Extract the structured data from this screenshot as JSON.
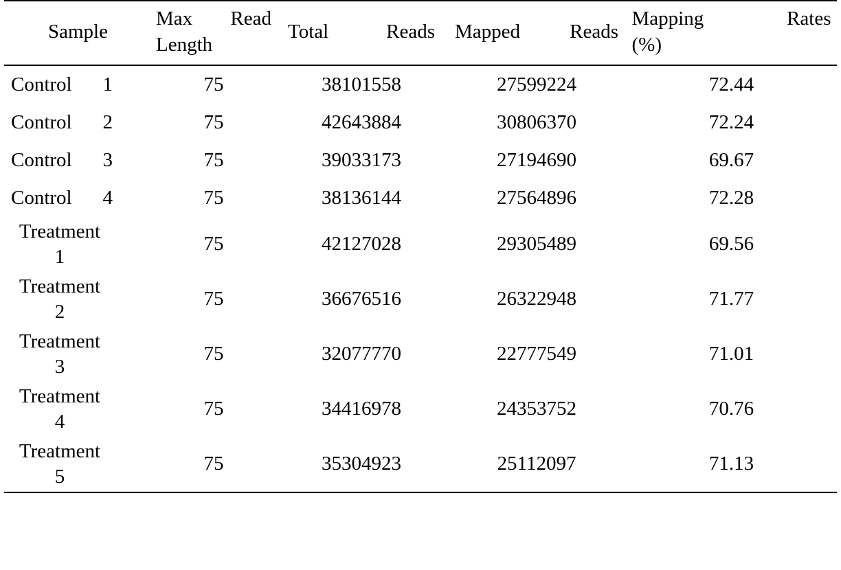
{
  "table": {
    "columns": [
      {
        "key": "sample",
        "label": "Sample"
      },
      {
        "key": "max_read_length",
        "label": "Max Read Length"
      },
      {
        "key": "total_reads",
        "label": "Total Reads"
      },
      {
        "key": "mapped_reads",
        "label": "Mapped Reads"
      },
      {
        "key": "mapping_rates",
        "label": "Mapping Rates (%)"
      }
    ],
    "header_lines": {
      "sample": {
        "line1": "Sample",
        "line2": ""
      },
      "max_read_length": {
        "line1": "Max Read",
        "line2": "Length"
      },
      "total_reads": {
        "line1": "Total Reads",
        "line2": ""
      },
      "mapped_reads": {
        "line1": "Mapped Reads",
        "line2": ""
      },
      "mapping_rates": {
        "line1": "Mapping Rates",
        "line2": "(%)"
      }
    },
    "rows": [
      {
        "sample": "Control 1",
        "sample_line1": "Control 1",
        "sample_line2": "",
        "max_read_length": "75",
        "total_reads": "38101558",
        "mapped_reads": "27599224",
        "mapping_rates": "72.44"
      },
      {
        "sample": "Control 2",
        "sample_line1": "Control 2",
        "sample_line2": "",
        "max_read_length": "75",
        "total_reads": "42643884",
        "mapped_reads": "30806370",
        "mapping_rates": "72.24"
      },
      {
        "sample": "Control 3",
        "sample_line1": "Control 3",
        "sample_line2": "",
        "max_read_length": "75",
        "total_reads": "39033173",
        "mapped_reads": "27194690",
        "mapping_rates": "69.67"
      },
      {
        "sample": "Control 4",
        "sample_line1": "Control 4",
        "sample_line2": "",
        "max_read_length": "75",
        "total_reads": "38136144",
        "mapped_reads": "27564896",
        "mapping_rates": "72.28"
      },
      {
        "sample": "Treatment 1",
        "sample_line1": "Treatment",
        "sample_line2": "1",
        "max_read_length": "75",
        "total_reads": "42127028",
        "mapped_reads": "29305489",
        "mapping_rates": "69.56"
      },
      {
        "sample": "Treatment 2",
        "sample_line1": "Treatment",
        "sample_line2": "2",
        "max_read_length": "75",
        "total_reads": "36676516",
        "mapped_reads": "26322948",
        "mapping_rates": "71.77"
      },
      {
        "sample": "Treatment 3",
        "sample_line1": "Treatment",
        "sample_line2": "3",
        "max_read_length": "75",
        "total_reads": "32077770",
        "mapped_reads": "22777549",
        "mapping_rates": "71.01"
      },
      {
        "sample": "Treatment 4",
        "sample_line1": "Treatment",
        "sample_line2": "4",
        "max_read_length": "75",
        "total_reads": "34416978",
        "mapped_reads": "24353752",
        "mapping_rates": "70.76"
      },
      {
        "sample": "Treatment 5",
        "sample_line1": "Treatment",
        "sample_line2": "5",
        "max_read_length": "75",
        "total_reads": "35304923",
        "mapped_reads": "25112097",
        "mapping_rates": "71.13"
      }
    ]
  }
}
